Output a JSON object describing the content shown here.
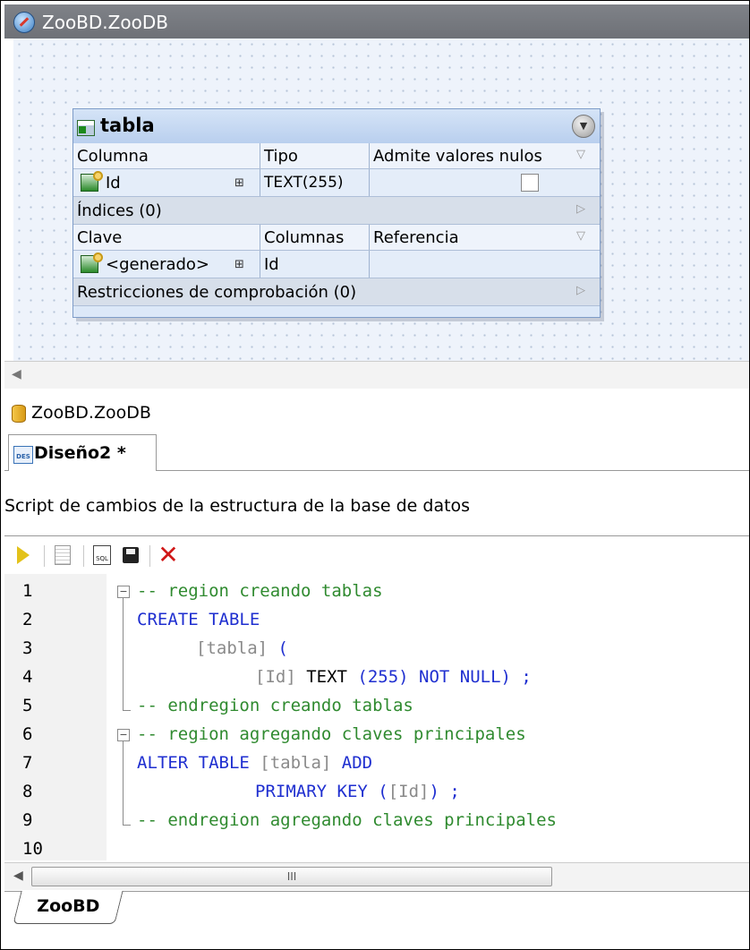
{
  "window": {
    "title": "ZooBD.ZooDB"
  },
  "table": {
    "name": "tabla",
    "columns_header": {
      "col1": "Columna",
      "col2": "Tipo",
      "col3": "Admite valores nulos"
    },
    "columns": [
      {
        "name": "Id",
        "type": "TEXT(255)",
        "nullable": false
      }
    ],
    "indices_label": "Índices (0)",
    "keys_header": {
      "col1": "Clave",
      "col2": "Columnas",
      "col3": "Referencia"
    },
    "keys": [
      {
        "name": "<generado>",
        "columns": "Id",
        "reference": ""
      }
    ],
    "checks_label": "Restricciones de comprobación (0)"
  },
  "db_label": "ZooBD.ZooDB",
  "tab": {
    "label": "Diseño2 *"
  },
  "script_title": "Script de cambios de la estructura de la base de datos",
  "code": {
    "line_numbers": [
      "1",
      "2",
      "3",
      "4",
      "5",
      "6",
      "7",
      "8",
      "9",
      "10"
    ],
    "l1": "-- region creando tablas",
    "l2": "CREATE TABLE",
    "l3a": "[tabla]",
    "l3b": " (",
    "l4a": "[Id]",
    "l4b": " TEXT",
    "l4c": " (255) NOT NULL) ;",
    "l5": "-- endregion creando tablas",
    "l6": "-- region agregando claves principales",
    "l7a": "ALTER TABLE",
    "l7b": " [tabla]",
    "l7c": " ADD",
    "l8a": "PRIMARY KEY (",
    "l8b": "[Id]",
    "l8c": ") ;",
    "l9": "-- endregion agregando claves principales"
  },
  "scroll_thumb": "III",
  "bottom_tab": "ZooBD"
}
